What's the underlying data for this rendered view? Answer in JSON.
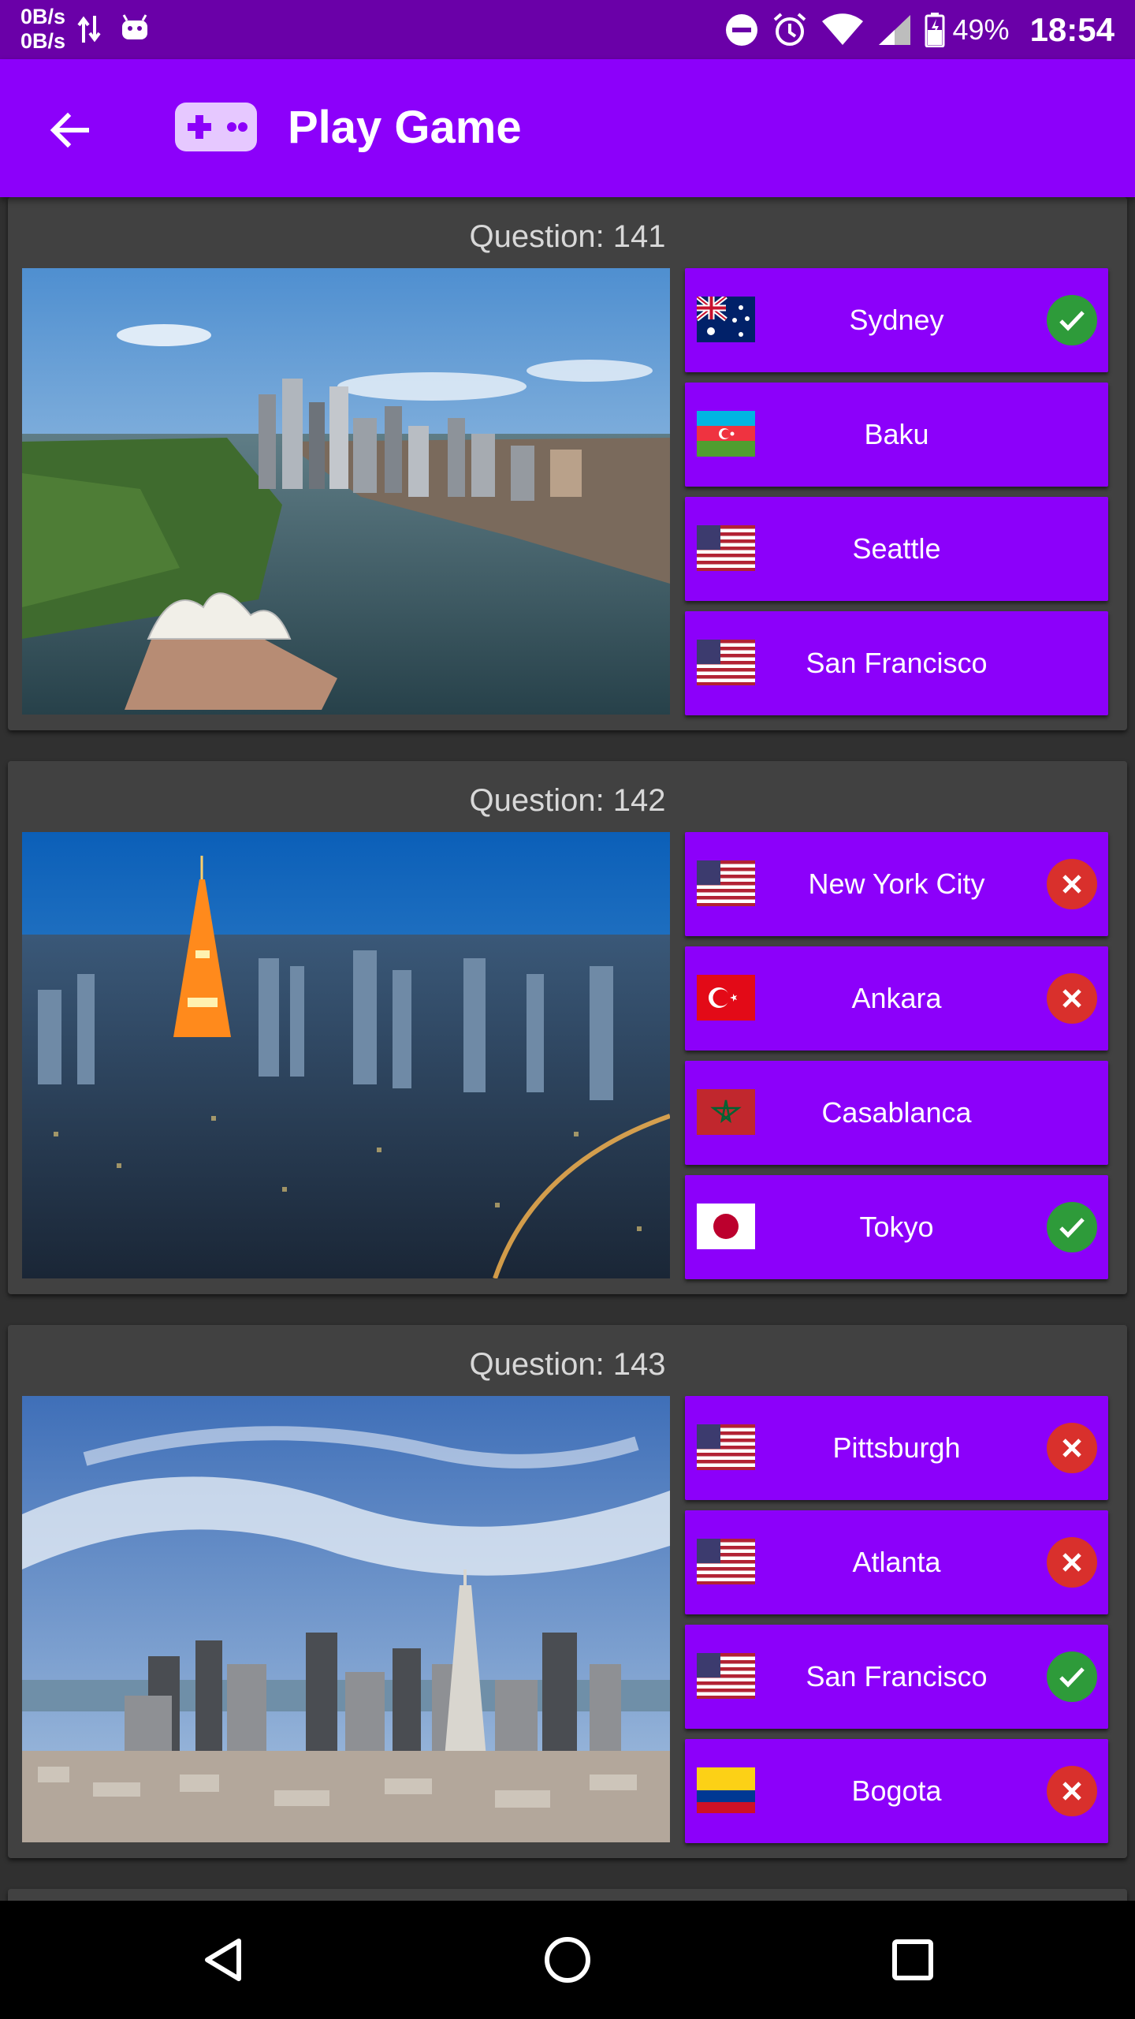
{
  "status_bar": {
    "net_speed_up": "0B/s",
    "net_speed_down": "0B/s",
    "battery_percent": "49%",
    "time": "18:54",
    "icons": [
      "data-transfer-icon",
      "android-icon",
      "do-not-disturb-icon",
      "alarm-icon",
      "wifi-icon",
      "signal-icon",
      "battery-icon"
    ]
  },
  "app_bar": {
    "title": "Play Game",
    "back_icon": "arrow-back-icon",
    "app_icon": "gamepad-icon"
  },
  "colors": {
    "status_bar": "#6a00a8",
    "app_bar": "#8c00fa",
    "background": "#303030",
    "card": "#414141",
    "answer_button": "#8c00fa",
    "correct": "#2e9b3a",
    "wrong": "#d9302c"
  },
  "questions": [
    {
      "label": "Question: 141",
      "image": "sydney-harbour-photo",
      "answers": [
        {
          "city": "Sydney",
          "flag": "australia",
          "result": "correct"
        },
        {
          "city": "Baku",
          "flag": "azerbaijan",
          "result": "none"
        },
        {
          "city": "Seattle",
          "flag": "usa",
          "result": "none"
        },
        {
          "city": "San Francisco",
          "flag": "usa",
          "result": "none"
        }
      ]
    },
    {
      "label": "Question: 142",
      "image": "tokyo-tower-photo",
      "answers": [
        {
          "city": "New York City",
          "flag": "usa",
          "result": "wrong"
        },
        {
          "city": "Ankara",
          "flag": "turkey",
          "result": "wrong"
        },
        {
          "city": "Casablanca",
          "flag": "morocco",
          "result": "none"
        },
        {
          "city": "Tokyo",
          "flag": "japan",
          "result": "correct"
        }
      ]
    },
    {
      "label": "Question: 143",
      "image": "san-francisco-skyline-photo",
      "answers": [
        {
          "city": "Pittsburgh",
          "flag": "usa",
          "result": "wrong"
        },
        {
          "city": "Atlanta",
          "flag": "usa",
          "result": "wrong"
        },
        {
          "city": "San Francisco",
          "flag": "usa",
          "result": "correct"
        },
        {
          "city": "Bogota",
          "flag": "colombia",
          "result": "wrong"
        }
      ]
    }
  ],
  "nav_bar": {
    "icons": [
      "back-triangle-icon",
      "home-circle-icon",
      "recents-square-icon"
    ]
  }
}
